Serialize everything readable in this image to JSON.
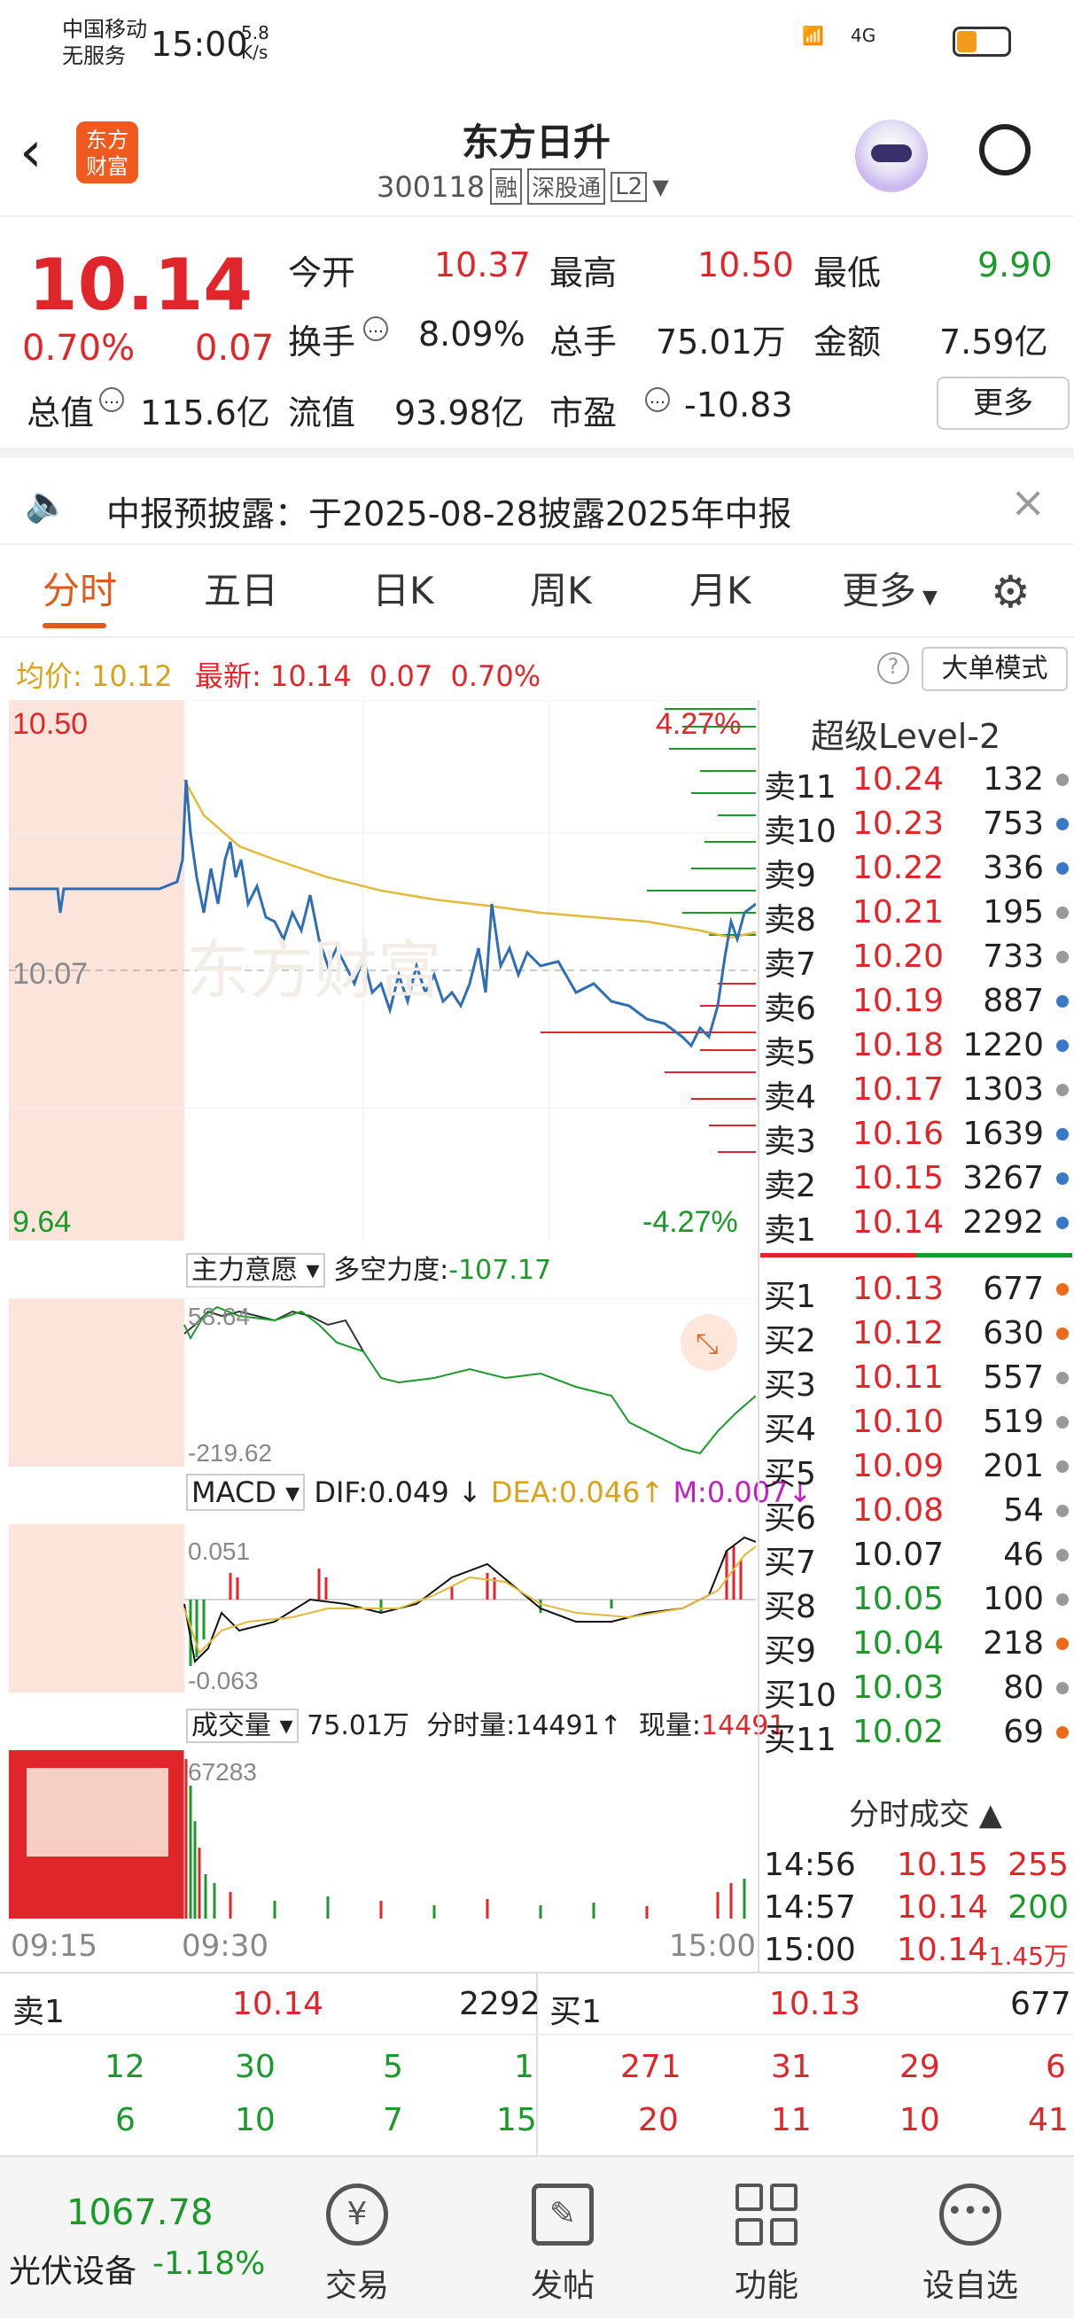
{
  "status": {
    "carrier1": "中国移动",
    "carrier2": "无服务",
    "time": "15:00",
    "speed": "5.8",
    "speed_unit": "K/s",
    "net": "4G"
  },
  "header": {
    "title": "东方日升",
    "code": "300118",
    "badges": [
      "融",
      "深股通",
      "L2"
    ],
    "logo": "东方\n财富"
  },
  "quote": {
    "price": "10.14",
    "pct": "0.70%",
    "chg": "0.07",
    "f": [
      {
        "label": "今开",
        "value": "10.37",
        "color": "red"
      },
      {
        "label": "最高",
        "value": "10.50",
        "color": "red"
      },
      {
        "label": "最低",
        "value": "9.90",
        "color": "green"
      },
      {
        "label": "换手",
        "value": "8.09%",
        "color": "black"
      },
      {
        "label": "总手",
        "value": "75.01万",
        "color": "black"
      },
      {
        "label": "金额",
        "value": "7.59亿",
        "color": "black"
      },
      {
        "label": "总值",
        "value": "115.6亿",
        "color": "black"
      },
      {
        "label": "流值",
        "value": "93.98亿",
        "color": "black"
      },
      {
        "label": "市盈",
        "value": "-10.83",
        "color": "black"
      }
    ],
    "more": "更多"
  },
  "notice": {
    "text": "中报预披露：于2025-08-28披露2025年中报"
  },
  "tabs": [
    "分时",
    "五日",
    "日K",
    "周K",
    "月K",
    "更多"
  ],
  "info": {
    "avg_label": "均价:",
    "avg": "10.12",
    "latest_label": "最新:",
    "latest": "10.14",
    "chg": "0.07",
    "pct": "0.70%",
    "big_order": "大单模式"
  },
  "chart": {
    "high": "10.50",
    "low": "9.64",
    "mid": "10.07",
    "up_pct": "4.27%",
    "down_pct": "-4.27%",
    "watermark": "东方财富",
    "ind1": {
      "name": "主力意愿",
      "label": "多空力度:",
      "value": "-107.17",
      "top": "58.64",
      "bottom": "-219.62"
    },
    "macd": {
      "name": "MACD",
      "dif": "DIF:0.049",
      "dea": "DEA:0.046",
      "m": "M:0.007",
      "top": "0.051",
      "bottom": "-0.063"
    },
    "vol": {
      "name": "成交量",
      "total": "75.01万",
      "fs_label": "分时量:14491",
      "now_label": "现量:",
      "now": "14491",
      "max": "67283"
    },
    "times": [
      "09:15",
      "09:30",
      "15:00"
    ]
  },
  "orderbook": {
    "title": "超级Level-2",
    "asks": [
      [
        "卖11",
        "10.24",
        "132",
        "#999"
      ],
      [
        "卖10",
        "10.23",
        "753",
        "#3a78c8"
      ],
      [
        "卖9",
        "10.22",
        "336",
        "#3a78c8"
      ],
      [
        "卖8",
        "10.21",
        "195",
        "#999"
      ],
      [
        "卖7",
        "10.20",
        "733",
        "#999"
      ],
      [
        "卖6",
        "10.19",
        "887",
        "#3a78c8"
      ],
      [
        "卖5",
        "10.18",
        "1220",
        "#3a78c8"
      ],
      [
        "卖4",
        "10.17",
        "1303",
        "#999"
      ],
      [
        "卖3",
        "10.16",
        "1639",
        "#3a78c8"
      ],
      [
        "卖2",
        "10.15",
        "3267",
        "#3a78c8"
      ],
      [
        "卖1",
        "10.14",
        "2292",
        "#3a78c8"
      ]
    ],
    "bids": [
      [
        "买1",
        "10.13",
        "677",
        "#ee6a1a"
      ],
      [
        "买2",
        "10.12",
        "630",
        "#ee6a1a"
      ],
      [
        "买3",
        "10.11",
        "557",
        "#999"
      ],
      [
        "买4",
        "10.10",
        "519",
        "#999"
      ],
      [
        "买5",
        "10.09",
        "201",
        "#999"
      ],
      [
        "买6",
        "10.08",
        "54",
        "#999"
      ],
      [
        "买7",
        "10.07",
        "46",
        "#999"
      ],
      [
        "买8",
        "10.05",
        "100",
        "#999"
      ],
      [
        "买9",
        "10.04",
        "218",
        "#ee6a1a"
      ],
      [
        "买10",
        "10.03",
        "80",
        "#999"
      ],
      [
        "买11",
        "10.02",
        "69",
        "#ee6a1a"
      ]
    ],
    "trades_title": "分时成交",
    "trades": [
      [
        "14:56",
        "10.15",
        "255"
      ],
      [
        "14:57",
        "10.14",
        "200"
      ],
      [
        "15:00",
        "10.14",
        "1.45万"
      ]
    ]
  },
  "bottom": {
    "sell_label": "卖1",
    "sell_price": "10.14",
    "sell_vol": "2292",
    "buy_label": "买1",
    "buy_price": "10.13",
    "buy_vol": "677",
    "left_r1": [
      "12",
      "30",
      "5",
      "1"
    ],
    "left_r2": [
      "6",
      "10",
      "7",
      "15"
    ],
    "right_r1": [
      "271",
      "31",
      "29",
      "6"
    ],
    "right_r2": [
      "20",
      "11",
      "10",
      "41"
    ]
  },
  "nav": {
    "index_value": "1067.78",
    "index_name": "光伏设备",
    "index_pct": "-1.18%",
    "items": [
      "交易",
      "发帖",
      "功能",
      "设自选"
    ]
  }
}
